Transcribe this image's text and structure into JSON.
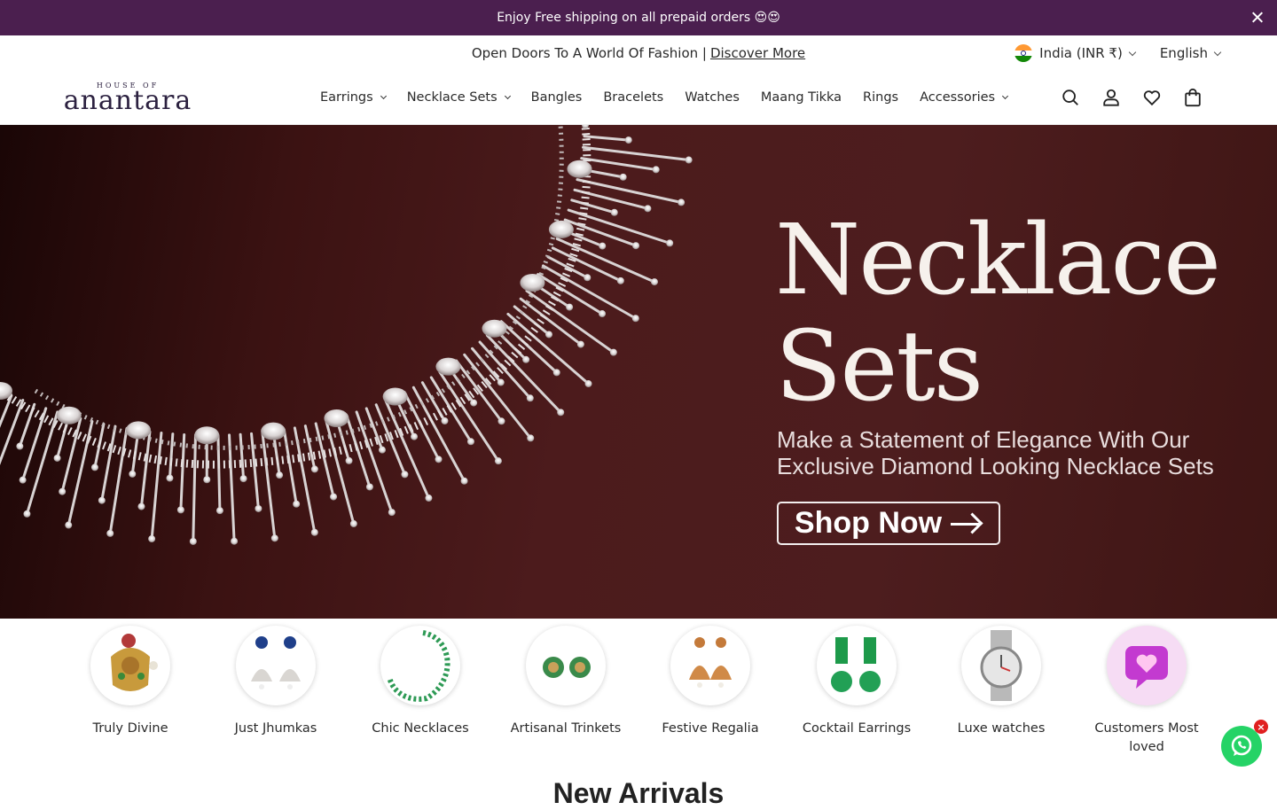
{
  "announcement": {
    "text": "Enjoy Free shipping on all prepaid orders 😍😍"
  },
  "utility_bar": {
    "promo_text": "Open Doors To A World Of Fashion |",
    "promo_link": "Discover More",
    "country": "India (INR ₹)",
    "language": "English"
  },
  "header": {
    "logo_top": "HOUSE OF",
    "logo_main": "anantara",
    "nav": [
      {
        "label": "Earrings",
        "has_dropdown": true
      },
      {
        "label": "Necklace Sets",
        "has_dropdown": true
      },
      {
        "label": "Bangles",
        "has_dropdown": false
      },
      {
        "label": "Bracelets",
        "has_dropdown": false
      },
      {
        "label": "Watches",
        "has_dropdown": false
      },
      {
        "label": "Maang Tikka",
        "has_dropdown": false
      },
      {
        "label": "Rings",
        "has_dropdown": false
      },
      {
        "label": "Accessories",
        "has_dropdown": true
      }
    ],
    "icons": [
      "search-icon",
      "account-icon",
      "wishlist-icon",
      "cart-icon"
    ]
  },
  "hero": {
    "title_line1": "Necklace",
    "title_line2": "Sets",
    "subtitle_line1": "Make a Statement of Elegance With Our",
    "subtitle_line2": "Exclusive Diamond Looking Necklace Sets",
    "cta": "Shop Now"
  },
  "categories": [
    {
      "label": "Truly Divine"
    },
    {
      "label": "Just Jhumkas"
    },
    {
      "label": "Chic Necklaces"
    },
    {
      "label": "Artisanal Trinkets"
    },
    {
      "label": "Festive Regalia"
    },
    {
      "label": "Cocktail Earrings"
    },
    {
      "label": "Luxe watches"
    },
    {
      "label": "Customers Most loved"
    }
  ],
  "section": {
    "title": "New Arrivals"
  },
  "colors": {
    "announcement_bg": "#4b1f4f",
    "hero_bg": "#4c1b1c",
    "whatsapp": "#25d366"
  }
}
